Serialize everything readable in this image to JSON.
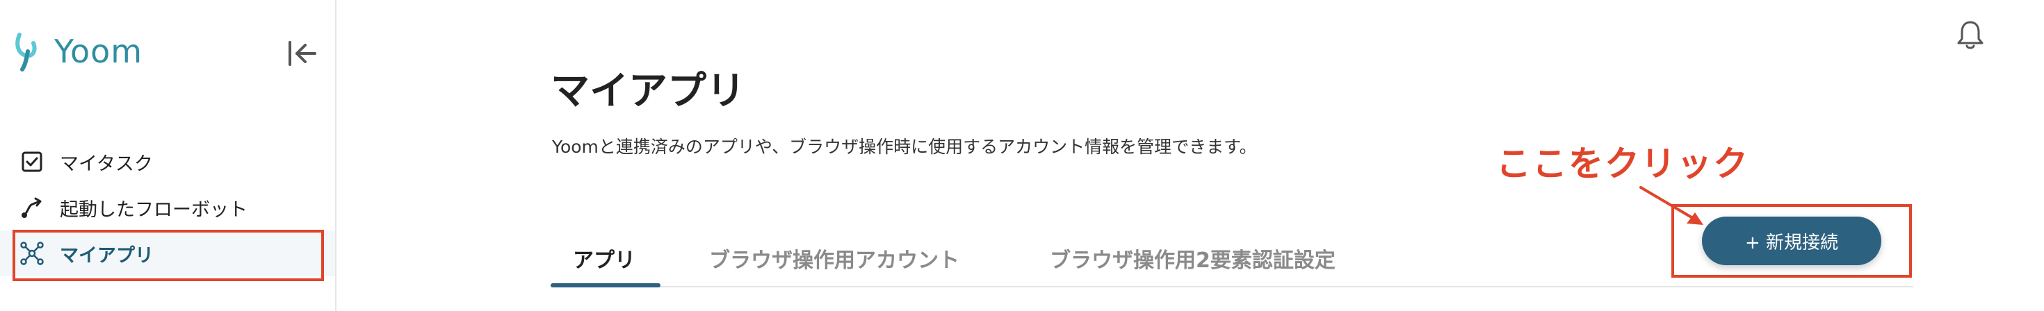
{
  "brand": {
    "name": "Yoom",
    "color": "#2f8fa0"
  },
  "sidebar": {
    "items": [
      {
        "label": "マイタスク",
        "icon": "checkbox-icon",
        "active": false
      },
      {
        "label": "起動したフローボット",
        "icon": "flow-icon",
        "active": false
      },
      {
        "label": "マイアプリ",
        "icon": "network-icon",
        "active": true
      }
    ]
  },
  "main": {
    "title": "マイアプリ",
    "description": "Yoomと連携済みのアプリや、ブラウザ操作時に使用するアカウント情報を管理できます。",
    "new_connection_label": "+ 新規接続",
    "tabs": [
      {
        "label": "アプリ",
        "active": true
      },
      {
        "label": "ブラウザ操作用アカウント",
        "active": false
      },
      {
        "label": "ブラウザ操作用2要素認証設定",
        "active": false
      }
    ]
  },
  "annotation": {
    "text": "ここをクリック",
    "color": "#e0452b"
  },
  "colors": {
    "accent": "#2c6180",
    "highlight": "#e0452b"
  }
}
